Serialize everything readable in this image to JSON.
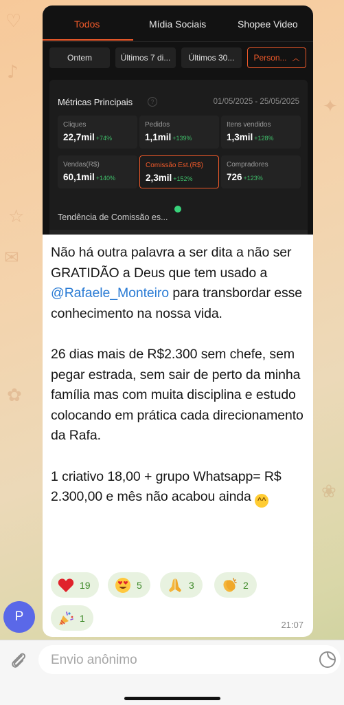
{
  "screenshot": {
    "tabs": [
      "Todos",
      "Mídia Sociais",
      "Shopee Video"
    ],
    "active_tab": "Todos",
    "filters": [
      "Ontem",
      "Últimos 7 di...",
      "Últimos 30...",
      "Person..."
    ],
    "metrics_title": "Métricas Principais",
    "date_range": "01/05/2025 - 25/05/2025",
    "metrics": [
      {
        "label": "Cliques",
        "value": "22,7mil",
        "delta": "+74%"
      },
      {
        "label": "Pedidos",
        "value": "1,1mil",
        "delta": "+139%"
      },
      {
        "label": "Itens vendidos",
        "value": "1,3mil",
        "delta": "+128%"
      },
      {
        "label": "Vendas(R$)",
        "value": "60,1mil",
        "delta": "+140%"
      },
      {
        "label": "Comissão Est.(R$)",
        "value": "2,3mil",
        "delta": "+152%"
      },
      {
        "label": "Compradores",
        "value": "726",
        "delta": "+123%"
      }
    ],
    "trend_title": "Tendência de Comissão es..."
  },
  "message": {
    "p1_before": "Não há outra palavra a ser dita a não ser GRATIDÃO a Deus que tem usado a ",
    "mention": "@Rafaele_Monteiro",
    "p1_after": " para transbordar esse conhecimento na nossa vida.",
    "p2": "26 dias mais de R$2.300 sem chefe, sem pegar estrada, sem sair de perto da minha família mas com muita disciplina e estudo colocando em prática cada direcionamento da Rafa.",
    "p3": "1 criativo 18,00 + grupo Whatsapp= R$ 2.300,00 e mês não acabou ainda",
    "time": "21:07"
  },
  "reactions": [
    {
      "emoji": "heart",
      "count": "19"
    },
    {
      "emoji": "heart-eyes",
      "count": "5"
    },
    {
      "emoji": "folded-hands",
      "count": "3"
    },
    {
      "emoji": "clapping-hands",
      "count": "2"
    },
    {
      "emoji": "party-popper",
      "count": "1"
    }
  ],
  "avatar": {
    "initial": "P",
    "color": "#5a68e8"
  },
  "composer": {
    "placeholder": "Envio anônimo"
  },
  "colors": {
    "accent": "#f05a2a",
    "delta_green": "#3fbf6a",
    "link": "#2a7bd4",
    "reaction_bg": "#e8f2e0"
  }
}
